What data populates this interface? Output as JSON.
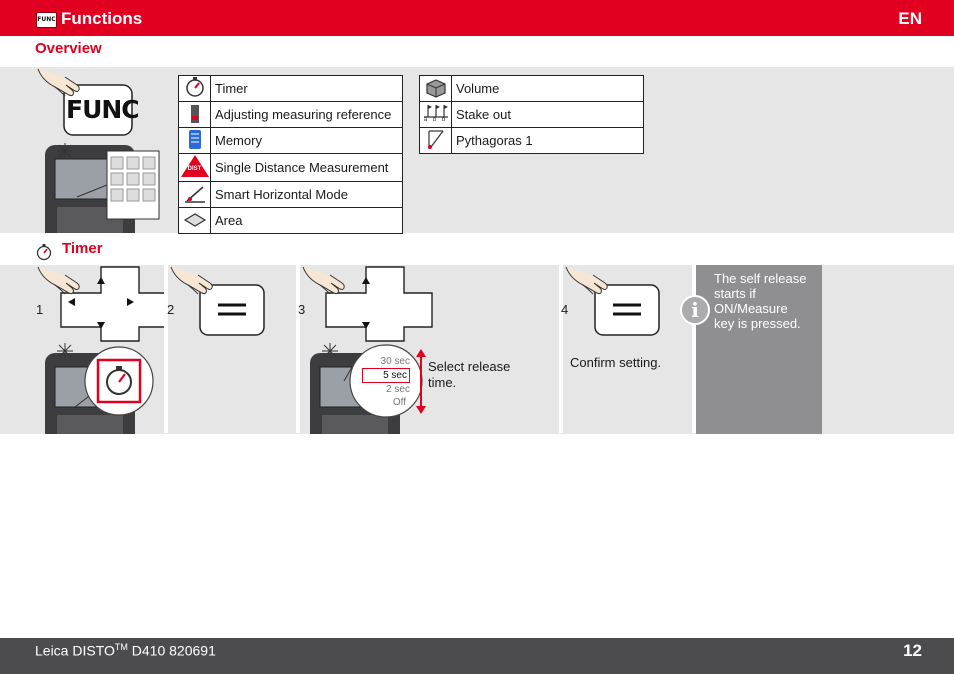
{
  "header": {
    "badge": "FUNC",
    "title": "Functions",
    "lang": "EN"
  },
  "overview": {
    "title": "Overview",
    "func_key_label": "FUNC",
    "table_left": [
      {
        "icon": "timer-icon",
        "label": "Timer"
      },
      {
        "icon": "measuring-reference-icon",
        "label": "Adjusting measuring reference"
      },
      {
        "icon": "memory-icon",
        "label": "Memory"
      },
      {
        "icon": "dist-icon",
        "label": "Single Distance Measurement",
        "icon_text": "DIST"
      },
      {
        "icon": "smart-horizontal-icon",
        "label": "Smart Horizontal Mode"
      },
      {
        "icon": "area-icon",
        "label": "Area"
      }
    ],
    "table_right": [
      {
        "icon": "volume-icon",
        "label": "Volume"
      },
      {
        "icon": "stake-out-icon",
        "label": "Stake out",
        "icon_text": "a b b"
      },
      {
        "icon": "pythagoras-icon",
        "label": "Pythagoras 1"
      }
    ]
  },
  "timer": {
    "title": "Timer",
    "steps": [
      {
        "num": "1"
      },
      {
        "num": "2"
      },
      {
        "num": "3",
        "caption_line1": "Select release",
        "caption_line2": "time.",
        "options": [
          "30 sec",
          "5 sec",
          "2 sec",
          "Off"
        ]
      },
      {
        "num": "4",
        "caption": "Confirm setting."
      }
    ],
    "info": {
      "icon": "i",
      "line1": "The self release",
      "line2": "starts if",
      "line3": "ON/Measure",
      "line4": "key is pressed."
    }
  },
  "footer": {
    "brand": "Leica DISTO",
    "tm": "TM",
    "model": " D410 820691",
    "page": "12"
  },
  "colors": {
    "accent": "#e1001f",
    "panel": "#e6e6e7",
    "footer": "#4c4c4e",
    "info": "#8f8f91"
  }
}
